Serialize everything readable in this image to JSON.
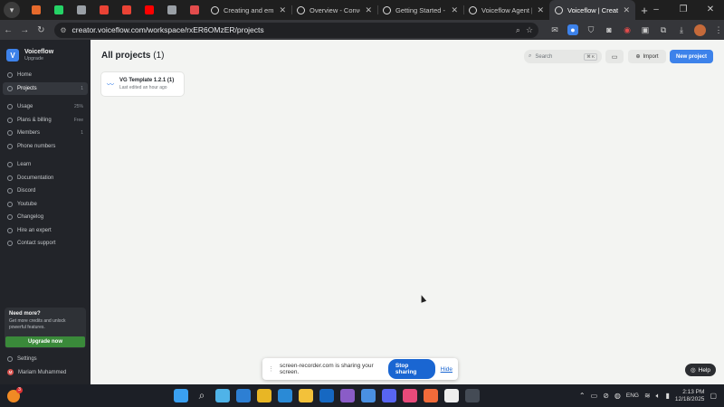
{
  "browser": {
    "pinned_tabs": [
      {
        "icon": "firefox-icon",
        "color": "#e66a2c"
      },
      {
        "icon": "whatsapp-icon",
        "color": "#25d366"
      },
      {
        "icon": "home-icon",
        "color": "#9aa0a6"
      },
      {
        "icon": "gmail-icon",
        "color": "#ea4335"
      },
      {
        "icon": "gmail-icon",
        "color": "#ea4335"
      },
      {
        "icon": "youtube-icon",
        "color": "#ff0000"
      },
      {
        "icon": "puzzle-icon",
        "color": "#9aa0a6"
      },
      {
        "icon": "record-icon",
        "color": "#e34c4c"
      }
    ],
    "tabs": [
      {
        "title": "Creating and embed",
        "active": false
      },
      {
        "title": "Overview - Convoco",
        "active": false
      },
      {
        "title": "Getting Started - Co",
        "active": false
      },
      {
        "title": "Voiceflow Agent | Ag",
        "active": false
      },
      {
        "title": "Voiceflow | Creator",
        "active": true
      }
    ],
    "url": "creator.voiceflow.com/workspace/rxER6OMzER/projects",
    "new_tab_symbol": "+"
  },
  "sidebar": {
    "brand_logo_letter": "V",
    "brand_name": "Voiceflow",
    "brand_sub": "Upgrade",
    "top_items": [
      {
        "label": "Home",
        "meta": ""
      },
      {
        "label": "Projects",
        "meta": "1",
        "active": true
      }
    ],
    "workspace_items": [
      {
        "label": "Usage",
        "meta": "25%"
      },
      {
        "label": "Plans & billing",
        "meta": "Free"
      },
      {
        "label": "Members",
        "meta": "1"
      },
      {
        "label": "Phone numbers",
        "meta": ""
      }
    ],
    "resource_items": [
      {
        "label": "Learn"
      },
      {
        "label": "Documentation"
      },
      {
        "label": "Discord"
      },
      {
        "label": "Youtube"
      },
      {
        "label": "Changelog"
      },
      {
        "label": "Hire an expert"
      },
      {
        "label": "Contact support"
      }
    ],
    "upsell": {
      "title": "Need more?",
      "text": "Get more credits and unlock powerful features.",
      "button": "Upgrade now"
    },
    "settings_label": "Settings",
    "user_name": "Mariam Muhammed",
    "user_initial": "M"
  },
  "main": {
    "title": "All projects",
    "title_count": "(1)",
    "search_placeholder": "Search",
    "search_shortcut": "⌘ K",
    "import_label": "Import",
    "new_project_label": "New project",
    "projects": [
      {
        "name": "VG Template 1.2.1 (1)",
        "subtitle": "Last edited an hour ago"
      }
    ]
  },
  "share_bar": {
    "message": "screen-recorder.com is sharing your screen.",
    "stop_label": "Stop sharing",
    "hide_label": "Hide"
  },
  "help_label": "Help",
  "taskbar": {
    "weather_badge": "3",
    "apps": [
      {
        "icon": "windows-start-icon",
        "color": "#3aa0f0"
      },
      {
        "icon": "search-icon",
        "color": "#dddddd"
      },
      {
        "icon": "copilot-icon",
        "color": "#4fb3e8"
      },
      {
        "icon": "store-icon",
        "color": "#2d7fd3"
      },
      {
        "icon": "chrome-icon",
        "color": "#e8b625"
      },
      {
        "icon": "vscode-icon",
        "color": "#2a8ad6"
      },
      {
        "icon": "file-explorer-icon",
        "color": "#f3c13a"
      },
      {
        "icon": "outlook-icon",
        "color": "#1668c2"
      },
      {
        "icon": "github-desktop-icon",
        "color": "#8a5cc7"
      },
      {
        "icon": "cloud-icon",
        "color": "#4a90e2"
      },
      {
        "icon": "discord-icon",
        "color": "#5865f2"
      },
      {
        "icon": "snipping-tool-icon",
        "color": "#e84a7a"
      },
      {
        "icon": "postman-icon",
        "color": "#f26b3a"
      },
      {
        "icon": "cursor-app-icon",
        "color": "#eeeeee"
      },
      {
        "icon": "terminal-icon",
        "color": "#444b55"
      }
    ],
    "language": "ENG",
    "time": "2:13 PM",
    "date": "12/18/2025"
  }
}
